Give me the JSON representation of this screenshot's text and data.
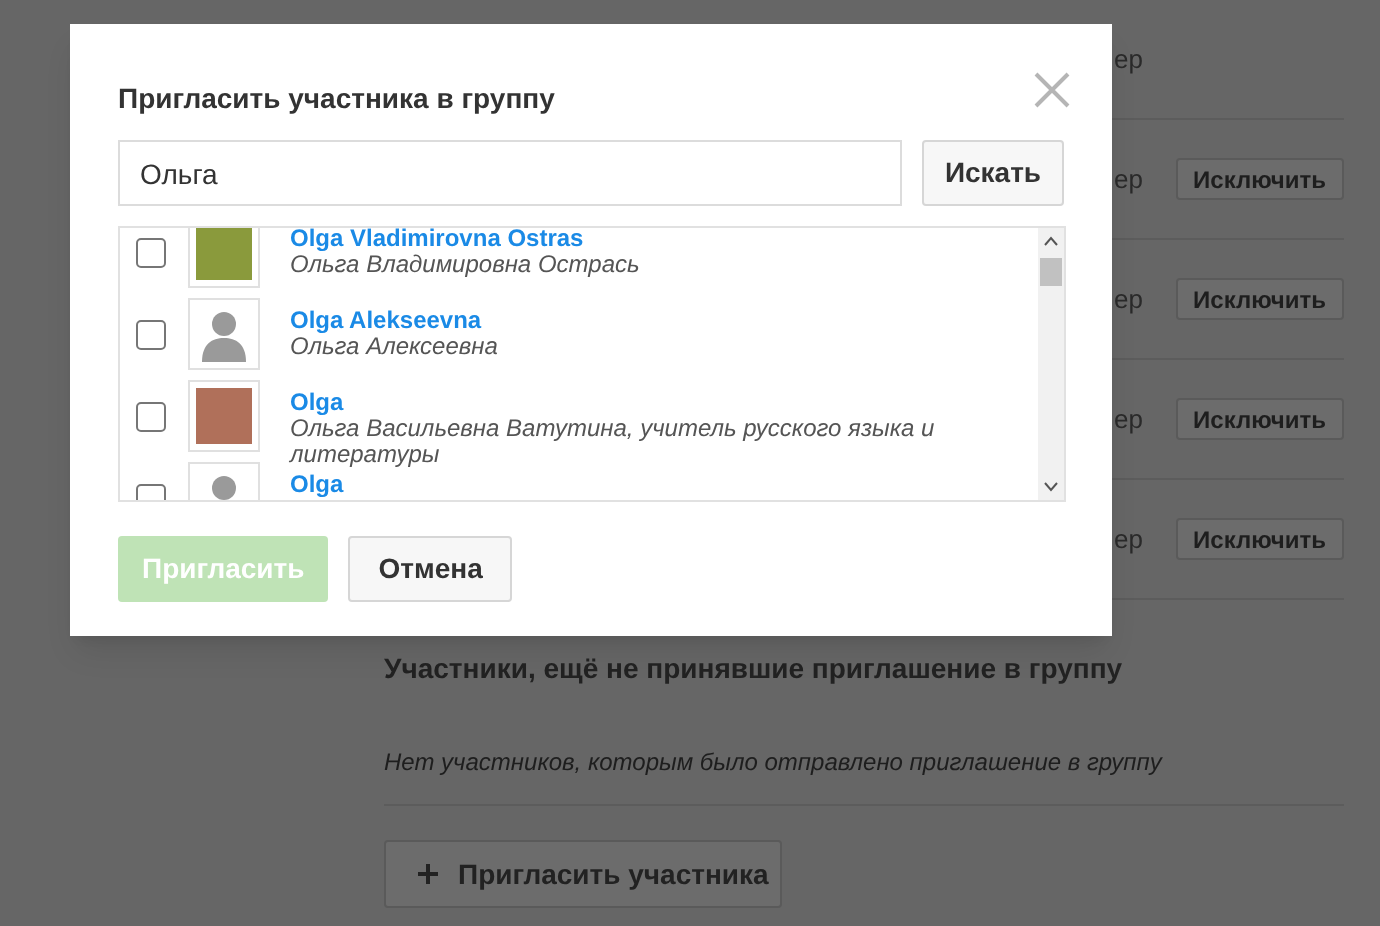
{
  "background_page": {
    "member_rows": [
      {
        "text": "ер",
        "button": null
      },
      {
        "text": "ер",
        "button": "Исключить"
      },
      {
        "text": "ер",
        "button": "Исключить"
      },
      {
        "text": "ер",
        "button": "Исключить"
      },
      {
        "text": "ер",
        "button": "Исключить"
      }
    ],
    "pending_heading": "Участники, ещё не принявшие приглашение в группу",
    "pending_empty": "Нет участников, которым было отправлено приглашение в группу",
    "invite_button": "Пригласить участника"
  },
  "dialog": {
    "title": "Пригласить участника в группу",
    "search": {
      "value": "Ольга",
      "button": "Искать"
    },
    "results": [
      {
        "name": "Olga Vladimirovna Ostras",
        "subtitle": "Ольга Владимировна Острась",
        "kind": "photo",
        "checked": false
      },
      {
        "name": "Olga Alekseevna",
        "subtitle": "Ольга Алексеевна",
        "kind": "placeholder",
        "checked": false
      },
      {
        "name": "Olga",
        "subtitle": "Ольга Васильевна Ватутина, учитель русского языка и литературы",
        "kind": "photo",
        "checked": false
      },
      {
        "name": "Olga",
        "kind": "placeholder",
        "checked": false
      }
    ],
    "invite_button": {
      "label": "Пригласить",
      "disabled": true
    },
    "cancel_button": "Отмена"
  }
}
